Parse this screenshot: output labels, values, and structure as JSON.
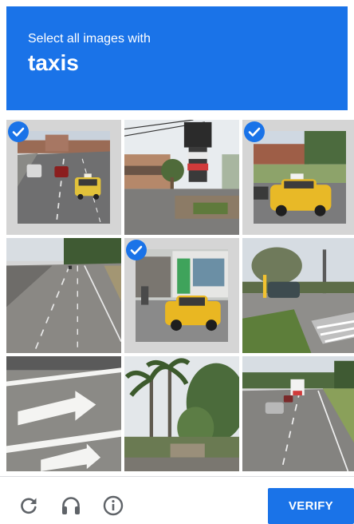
{
  "header": {
    "instruction": "Select all images with",
    "target": "taxis",
    "background_color": "#1a73e8"
  },
  "tiles": [
    {
      "scene": "highway-with-taxi",
      "selected": true
    },
    {
      "scene": "strip-mall-sign",
      "selected": false
    },
    {
      "scene": "taxi-in-parking-lot",
      "selected": true
    },
    {
      "scene": "empty-highway",
      "selected": false
    },
    {
      "scene": "taxi-at-storefront",
      "selected": true
    },
    {
      "scene": "road-intersection",
      "selected": false
    },
    {
      "scene": "road-arrow-markings",
      "selected": false
    },
    {
      "scene": "palm-trees",
      "selected": false
    },
    {
      "scene": "road-with-truck",
      "selected": false
    }
  ],
  "footer": {
    "reload_icon": "reload-icon",
    "audio_icon": "headphones-icon",
    "info_icon": "info-icon",
    "verify_label": "VERIFY"
  },
  "colors": {
    "accent": "#1a73e8",
    "icon_gray": "#5f6368",
    "taxi_yellow": "#f2c230"
  }
}
